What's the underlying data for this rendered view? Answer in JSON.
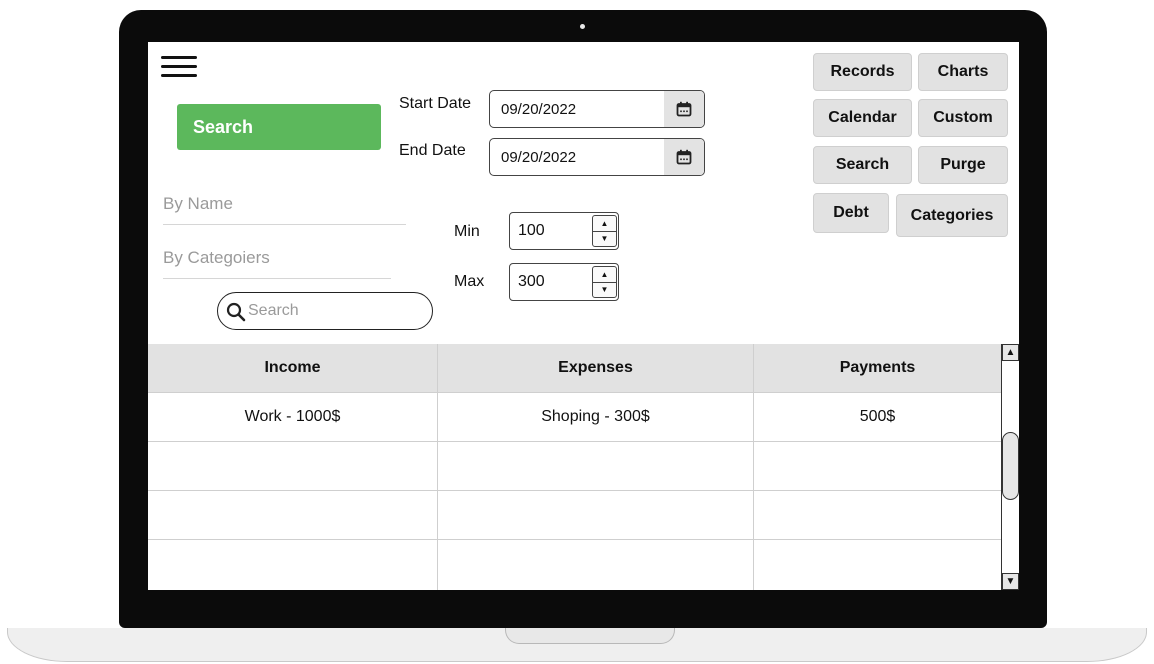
{
  "toolbar": {
    "search_label": "Search"
  },
  "dates": {
    "start_label": "Start Date",
    "start_value": "09/20/2022",
    "end_label": "End Date",
    "end_value": "09/20/2022"
  },
  "filters": {
    "by_name_placeholder": "By Name",
    "by_categories_placeholder": "By Categoiers",
    "search_placeholder": "Search"
  },
  "range": {
    "min_label": "Min",
    "min_value": "100",
    "max_label": "Max",
    "max_value": "300"
  },
  "nav": {
    "records": "Records",
    "charts": "Charts",
    "calendar": "Calendar",
    "custom": "Custom",
    "search": "Search",
    "purge": "Purge",
    "debt": "Debt",
    "categories": "Categories"
  },
  "table": {
    "headers": [
      "Income",
      "Expenses",
      "Payments"
    ],
    "rows": [
      [
        "Work - 1000$",
        "Shoping - 300$",
        "500$"
      ],
      [
        "",
        "",
        ""
      ],
      [
        "",
        "",
        ""
      ],
      [
        "",
        "",
        ""
      ]
    ]
  },
  "colors": {
    "accent_green": "#5cb85c",
    "button_gray": "#e2e2e2"
  },
  "icons": {
    "menu": "hamburger-menu-icon",
    "calendar": "calendar-icon",
    "search": "magnifier-icon",
    "scroll_up": "triangle-up-icon",
    "scroll_down": "triangle-down-icon"
  }
}
